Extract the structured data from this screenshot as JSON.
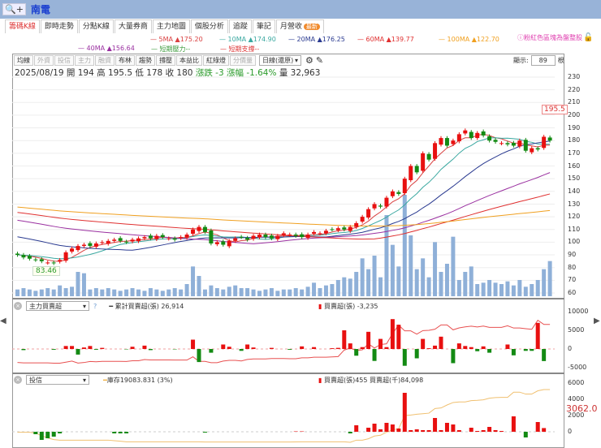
{
  "header": {
    "search_icon": "magnifier-plus-icon",
    "stock_name": "南電"
  },
  "tabs": [
    {
      "label": "籌碼K線",
      "active": true
    },
    {
      "label": "即時走勢"
    },
    {
      "label": "分點K線"
    },
    {
      "label": "大量券商"
    },
    {
      "label": "主力地圖"
    },
    {
      "label": "個股分析"
    },
    {
      "label": "追蹤"
    },
    {
      "label": "筆記"
    },
    {
      "label": "月營收",
      "badge": "最新"
    }
  ],
  "legend": {
    "row1": [
      {
        "label": "5MA ▲175.20",
        "color": "#d94040"
      },
      {
        "label": "10MA ▲174.90",
        "color": "#3aa8a0"
      },
      {
        "label": "20MA ▲176.25",
        "color": "#2a3a90"
      },
      {
        "label": "60MA ▲139.77",
        "color": "#e03030"
      },
      {
        "label": "100MA ▲122.70",
        "color": "#f0a020"
      }
    ],
    "row2": [
      {
        "label": "40MA ▲156.64",
        "color": "#9a30a0"
      },
      {
        "label": "短期壓力--",
        "color": "#3a9a3a"
      },
      {
        "label": "短期支撐--",
        "color": "#d33"
      }
    ],
    "hint": "ⓘ粉紅色區塊為盤整股"
  },
  "toolbar": {
    "buttons": [
      {
        "label": "均線"
      },
      {
        "label": "外資",
        "disabled": true
      },
      {
        "label": "投信",
        "disabled": true
      },
      {
        "label": "主力",
        "disabled": true
      },
      {
        "label": "融資",
        "disabled": true
      },
      {
        "label": "布林"
      },
      {
        "label": "趨勢"
      },
      {
        "label": "撐壓"
      },
      {
        "label": "本益比"
      },
      {
        "label": "紅綠燈"
      },
      {
        "label": "分價量",
        "disabled": true
      }
    ],
    "period": "日線(還原)",
    "show_label": "顯示:",
    "show_count": "89",
    "show_unit": "根"
  },
  "info": {
    "date": "2025/08/19",
    "open": "開 194",
    "high": "高 195.5",
    "low": "低 178",
    "close": "收 180",
    "change": "漲跌 -3",
    "pct": "漲幅 -1.64%",
    "volume": "量 32,963"
  },
  "price_tags": {
    "low": "83.46",
    "high": "195.5"
  },
  "price_axis": [
    "230",
    "220",
    "210",
    "200",
    "190",
    "180",
    "170",
    "160",
    "150",
    "140",
    "130",
    "120",
    "110",
    "100",
    "90",
    "80",
    "70",
    "60"
  ],
  "indicator1": {
    "select": "主力買賣超",
    "help": "?",
    "line_label": "累計買賣超(張) 26,914",
    "bar_label": "買賣超(張) -3,235",
    "axis": [
      "10000",
      "5000",
      "0",
      "-5000"
    ]
  },
  "indicator2": {
    "select": "投信",
    "line_label": "庫存19083.831 (3%)",
    "bar_label": "買賣超(張)455 買賣超(千)84,098",
    "axis": [
      "6000",
      "4000",
      "2000",
      "0"
    ],
    "last_value": "3062.0"
  },
  "colors": {
    "up": "#e81010",
    "down": "#138a13",
    "volume": "#8fb0d8"
  },
  "chart_data": {
    "type": "candlestick",
    "bars": 89,
    "close": [
      90,
      88,
      87,
      86,
      85,
      84,
      83.5,
      86,
      92,
      95,
      97,
      98,
      97,
      99,
      100,
      101,
      102,
      101,
      100,
      102,
      103,
      104,
      103,
      105,
      104,
      103,
      102,
      104,
      106,
      110,
      112,
      108,
      99,
      100,
      98,
      101,
      103,
      104,
      102,
      105,
      106,
      104,
      103,
      105,
      107,
      106,
      105,
      104,
      106,
      108,
      107,
      109,
      110,
      111,
      110,
      112,
      115,
      120,
      126,
      130,
      128,
      135,
      140,
      138,
      150,
      160,
      155,
      170,
      165,
      178,
      182,
      176,
      180,
      185,
      188,
      182,
      186,
      184,
      180,
      179,
      178,
      177,
      176,
      180,
      172,
      174,
      173,
      183,
      180
    ],
    "volume": [
      5,
      6,
      5,
      4,
      5,
      6,
      5,
      8,
      6,
      7,
      18,
      17,
      5,
      6,
      5,
      6,
      5,
      4,
      5,
      6,
      5,
      4,
      6,
      5,
      4,
      5,
      6,
      5,
      9,
      22,
      15,
      5,
      8,
      6,
      5,
      7,
      8,
      6,
      6,
      5,
      4,
      5,
      6,
      4,
      5,
      5,
      6,
      5,
      7,
      10,
      6,
      8,
      9,
      12,
      14,
      13,
      18,
      28,
      20,
      30,
      14,
      60,
      38,
      22,
      75,
      45,
      20,
      28,
      14,
      40,
      18,
      24,
      44,
      12,
      18,
      22,
      9,
      10,
      12,
      10,
      9,
      11,
      8,
      12,
      7,
      9,
      12,
      20,
      26
    ],
    "inst_net": [
      0,
      -300,
      0,
      0,
      0,
      0,
      -200,
      0,
      800,
      800,
      -1500,
      400,
      800,
      -200,
      300,
      0,
      0,
      0,
      -100,
      600,
      0,
      900,
      -300,
      0,
      0,
      0,
      -100,
      0,
      0,
      2500,
      -3500,
      0,
      -1000,
      0,
      1200,
      600,
      0,
      -500,
      1200,
      400,
      0,
      0,
      300,
      0,
      0,
      -200,
      0,
      700,
      0,
      500,
      0,
      0,
      200,
      300,
      5000,
      1500,
      -1800,
      500,
      4600,
      -3200,
      2700,
      500,
      8000,
      6500,
      -4500,
      0,
      -2500,
      2700,
      200,
      900,
      3300,
      0,
      -3800,
      1500,
      800,
      500,
      -600,
      700,
      -1000,
      0,
      0,
      1200,
      -1700,
      0,
      -500,
      -500,
      7000,
      -3235,
      0
    ],
    "trust_net": [
      0,
      0,
      0,
      -300,
      -1000,
      -800,
      -600,
      -200,
      0,
      0,
      0,
      0,
      0,
      0,
      0,
      0,
      -200,
      -200,
      -200,
      0,
      0,
      0,
      0,
      0,
      0,
      0,
      0,
      0,
      0,
      0,
      0,
      -100,
      0,
      0,
      0,
      0,
      0,
      0,
      0,
      0,
      0,
      0,
      0,
      0,
      0,
      0,
      50,
      50,
      0,
      0,
      0,
      0,
      0,
      0,
      0,
      -200,
      800,
      0,
      500,
      1000,
      300,
      1100,
      900,
      400,
      4800,
      200,
      300,
      200,
      200,
      1700,
      200,
      1100,
      900,
      200,
      0,
      500,
      100,
      200,
      600,
      200,
      100,
      0,
      1900,
      0,
      -700,
      0,
      1200,
      455,
      0
    ]
  }
}
